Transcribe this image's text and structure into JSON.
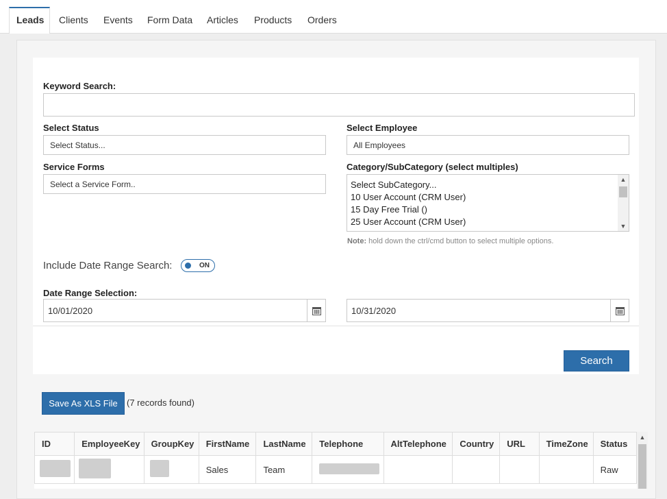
{
  "tabs": [
    "Leads",
    "Clients",
    "Events",
    "Form Data",
    "Articles",
    "Products",
    "Orders"
  ],
  "form": {
    "keyword_label": "Keyword Search:",
    "keyword_value": "",
    "status_label": "Select Status",
    "status_value": "Select Status...",
    "employee_label": "Select Employee",
    "employee_value": "All Employees",
    "service_label": "Service Forms",
    "service_value": "Select a Service Form..",
    "category_label": "Category/SubCategory (select multiples)",
    "category_options": [
      "Select SubCategory...",
      "10 User Account (CRM User)",
      "15 Day Free Trial ()",
      "25 User Account (CRM User)"
    ],
    "note_bold": "Note:",
    "note_text": " hold down the ctrl/cmd button to select multiple options.",
    "date_range_toggle_label": "Include Date Range Search:",
    "toggle_state": "ON",
    "date_range_label": "Date Range Selection:",
    "date_from": "10/01/2020",
    "date_to": "10/31/2020",
    "search_button": "Search"
  },
  "results": {
    "save_button": "Save As XLS File",
    "records_found": "(7 records found)"
  },
  "table": {
    "columns": [
      "ID",
      "EmployeeKey",
      "GroupKey",
      "FirstName",
      "LastName",
      "Telephone",
      "AltTelephone",
      "Country",
      "URL",
      "TimeZone",
      "Status"
    ],
    "rows": [
      {
        "FirstName": "Sales",
        "LastName": "Team",
        "Status": "Raw"
      }
    ]
  },
  "colors": {
    "accent": "#2d6eaa"
  }
}
